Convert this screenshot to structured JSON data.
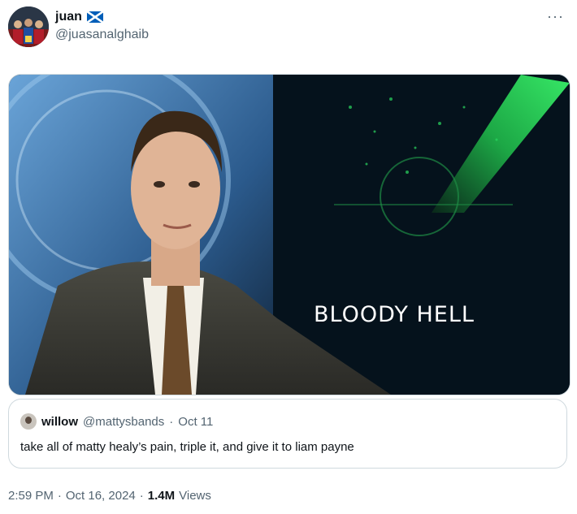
{
  "author": {
    "display_name": "juan",
    "handle": "@juasanalghaib",
    "avatar": "team-photo-avatar",
    "flag": "scotland-flag-icon"
  },
  "menu": {
    "more_label": "···"
  },
  "media": {
    "caption": "BLOODY HELL",
    "description_icon": "news-anchor-image"
  },
  "quote": {
    "display_name": "willow",
    "handle": "@mattysbands",
    "separator": "·",
    "date": "Oct 11",
    "text": "take all of matty healy’s pain, triple it, and give it to liam payne"
  },
  "meta": {
    "time": "2:59 PM",
    "separator": "·",
    "date": "Oct 16, 2024",
    "views_count": "1.4M",
    "views_label": "Views"
  },
  "colors": {
    "text_primary": "#0f1419",
    "text_secondary": "#536471",
    "border": "#cfd9de",
    "flag_blue": "#005eb8"
  }
}
